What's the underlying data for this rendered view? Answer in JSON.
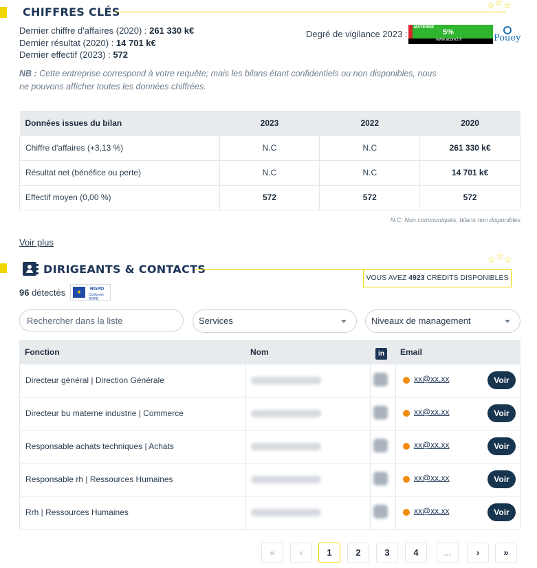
{
  "chiffres": {
    "title": "CHIFFRES CLÉS",
    "ca_label": "Dernier chiffre d'affaires (2020) : ",
    "ca_value": "261 330 k€",
    "res_label": "Dernier résultat (2020) : ",
    "res_value": "14 701 k€",
    "eff_label": "Dernier effectif (2023) : ",
    "eff_value": "572",
    "vigilance_label": "Degré de vigilance 2023 :",
    "vigilance_category": "MATERNE",
    "vigilance_pct": "5%",
    "vigilance_site": "www.acore3.fr",
    "brand_logo": "Pouey",
    "nb_label": "NB :",
    "nb_text": " Cette entreprise correspond à votre requête; mais les bilans étant confidentiels ou non disponibles, nous ne pouvons afficher toutes les données chiffrées."
  },
  "bilan": {
    "headers": [
      "Données issues du bilan",
      "2023",
      "2022",
      "2020"
    ],
    "rows": [
      [
        "Chiffre d'affaires (+3,13 %)",
        "N.C",
        "N.C",
        "261 330 k€"
      ],
      [
        "Résultat net (bénéfice ou perte)",
        "N.C",
        "N.C",
        "14 701 k€"
      ],
      [
        "Effectif moyen (0,00 %)",
        "572",
        "572",
        "572"
      ]
    ],
    "note": "N.C: Non communiqués, bilans non disponibles",
    "voir_plus": "Voir plus"
  },
  "dirigeants": {
    "title": "DIRIGEANTS & CONTACTS",
    "credits_prefix": "VOUS AVEZ ",
    "credits_value": "4923",
    "credits_suffix": " CRÉDITS DISPONIBLES",
    "detected_count": "96",
    "detected_label": " détectés",
    "rgpd_label": "RGPD",
    "rgpd_sub": "Conforme RGPD",
    "search_placeholder": "Rechercher dans la liste",
    "services_select": "Services",
    "niveaux_select": "Niveaux de management",
    "columns": {
      "fonction": "Fonction",
      "nom": "Nom",
      "linkedin": "in",
      "email": "Email"
    },
    "contacts": [
      {
        "fonction": "Directeur général | Direction Générale",
        "email": "xx@xx.xx",
        "action": "Voir"
      },
      {
        "fonction": "Directeur bu materne industrie | Commerce",
        "email": "xx@xx.xx",
        "action": "Voir"
      },
      {
        "fonction": "Responsable achats techniques | Achats",
        "email": "xx@xx.xx",
        "action": "Voir"
      },
      {
        "fonction": "Responsable rh | Ressources Humaines",
        "email": "xx@xx.xx",
        "action": "Voir"
      },
      {
        "fonction": "Rrh | Ressources Humaines",
        "email": "xx@xx.xx",
        "action": "Voir"
      }
    ]
  },
  "pagination": {
    "first": "«",
    "prev": "‹",
    "pages": [
      "1",
      "2",
      "3",
      "4"
    ],
    "current": "1",
    "ellipsis": "...",
    "next": "›",
    "last": "»"
  },
  "colors": {
    "accent_yellow": "#f2d600",
    "navy": "#1d3557",
    "status_orange": "#f28c0f"
  }
}
